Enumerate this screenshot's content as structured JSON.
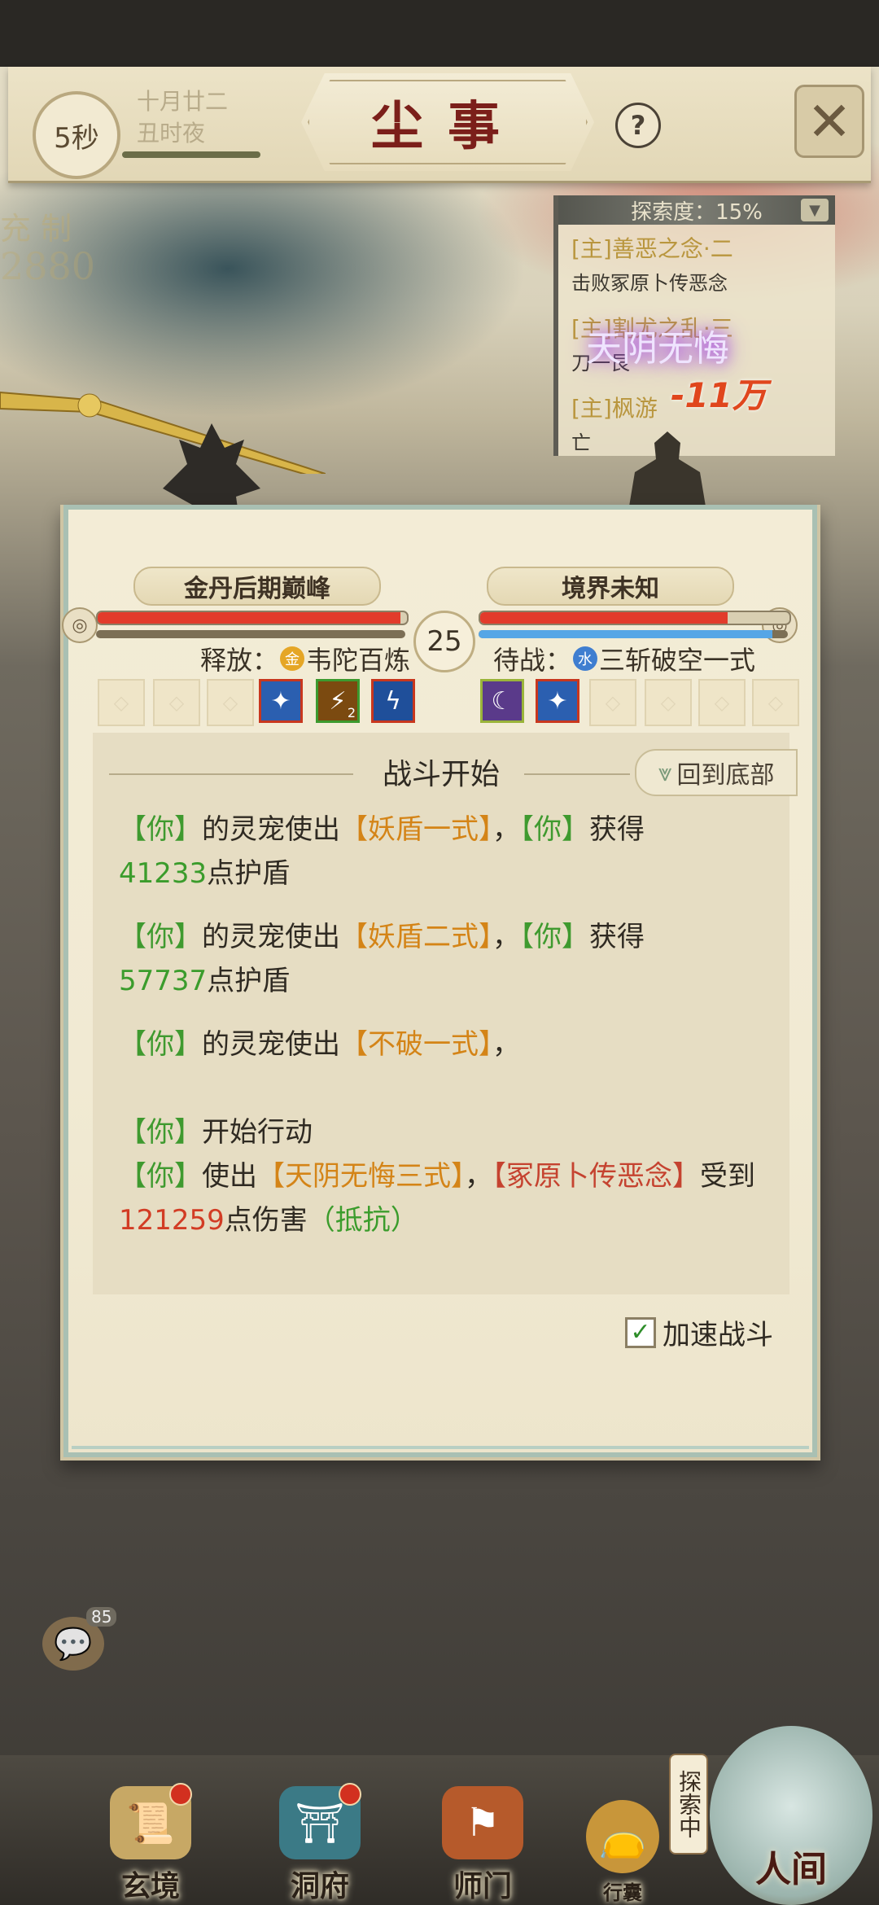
{
  "header": {
    "timer": "5秒",
    "date_line1": "十月廿二",
    "date_line2": "丑时夜",
    "title": "尘事",
    "help_icon": "?",
    "close_icon": "✕"
  },
  "background": {
    "stat_label": "充 制",
    "stat_value": "2880"
  },
  "quest_panel": {
    "header": "探索度：15%",
    "items": [
      {
        "title": "[主]善恶之念·二",
        "desc": "击败冢原卜传恶念"
      },
      {
        "title": "[主]割尤之乱·三",
        "desc": "刀一艮"
      },
      {
        "title": "[主]枫游",
        "desc": "亡"
      }
    ]
  },
  "effects": {
    "skill_name": "天阴无悔",
    "damage": "-11万"
  },
  "battle": {
    "left": {
      "realm": "金丹后期巅峰",
      "hp_fraction": 0.98,
      "sub_fraction": 0.0
    },
    "right": {
      "realm": "境界未知",
      "hp_fraction": 0.8,
      "sub_fraction": 0.95
    },
    "round": "25",
    "left_status": {
      "prefix": "释放：",
      "element": "金",
      "skill": "韦陀百炼"
    },
    "right_status": {
      "prefix": "待战：",
      "element": "水",
      "skill": "三斩破空一式"
    },
    "skill_badge": "2"
  },
  "log": {
    "title": "战斗开始",
    "scroll_bottom": "回到底部",
    "entries": [
      {
        "a": "【你】",
        "b": "的灵宠使出",
        "c": "【妖盾一式】",
        "d": "，",
        "e": "【你】",
        "f": "获得",
        "g": "41233",
        "h": "点护盾"
      },
      {
        "a": "【你】",
        "b": "的灵宠使出",
        "c": "【妖盾二式】",
        "d": "，",
        "e": "【你】",
        "f": "获得",
        "g": "57737",
        "h": "点护盾"
      },
      {
        "a": "【你】",
        "b": "的灵宠使出",
        "c": "【不破一式】",
        "d": "，"
      }
    ],
    "action_line": {
      "a": "【你】",
      "b": "开始行动"
    },
    "attack_line": {
      "a": "【你】",
      "b": "使出",
      "c": "【天阴无悔三式】",
      "d": "，",
      "e": "【冢原卜传恶念】",
      "f": "受到",
      "g": "121259",
      "h": "点伤害",
      "i": "（抵抗）"
    },
    "speed_label": "加速战斗",
    "speed_checked": true
  },
  "chat": {
    "count": "85"
  },
  "nav": {
    "items": [
      {
        "label": "玄境"
      },
      {
        "label": "洞府"
      },
      {
        "label": "师门"
      },
      {
        "label": "行囊"
      }
    ],
    "explore_tag": "探索中",
    "human_realm": "人间"
  },
  "colors": {
    "accent_red": "#7b1f1a",
    "log_green": "#3f9a2f",
    "log_orange": "#d48417",
    "hp_red": "#e23b2b",
    "mana_blue": "#56a6e6"
  }
}
